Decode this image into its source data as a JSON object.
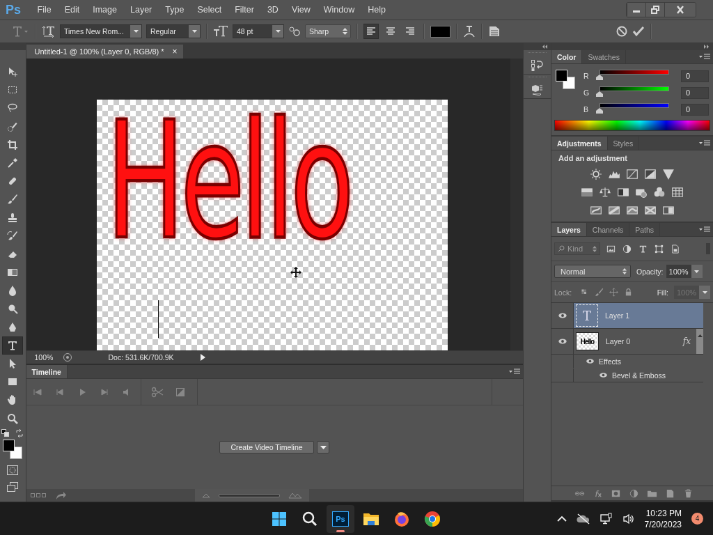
{
  "app": {
    "logo": "Ps",
    "menus": [
      "File",
      "Edit",
      "Image",
      "Layer",
      "Type",
      "Select",
      "Filter",
      "3D",
      "View",
      "Window",
      "Help"
    ]
  },
  "options_bar": {
    "font_family": "Times New Rom...",
    "font_style": "Regular",
    "font_size": "48 pt",
    "antialias": "Sharp",
    "align": [
      {
        "kind": "left",
        "selected": true
      },
      {
        "kind": "center",
        "selected": false
      },
      {
        "kind": "right",
        "selected": false
      }
    ]
  },
  "tools": [
    {
      "kind": "move",
      "selected": false
    },
    {
      "kind": "marquee",
      "selected": false
    },
    {
      "kind": "lasso",
      "selected": false
    },
    {
      "kind": "quick-select",
      "selected": false
    },
    {
      "kind": "crop",
      "selected": false
    },
    {
      "kind": "eyedropper",
      "selected": false
    },
    {
      "kind": "healing",
      "selected": false
    },
    {
      "kind": "brush",
      "selected": false
    },
    {
      "kind": "stamp",
      "selected": false
    },
    {
      "kind": "history-brush",
      "selected": false
    },
    {
      "kind": "eraser",
      "selected": false
    },
    {
      "kind": "gradient",
      "selected": false
    },
    {
      "kind": "blur",
      "selected": false
    },
    {
      "kind": "dodge",
      "selected": false
    },
    {
      "kind": "pen",
      "selected": false
    },
    {
      "kind": "type",
      "selected": true
    },
    {
      "kind": "path-select",
      "selected": false
    },
    {
      "kind": "shape",
      "selected": false
    },
    {
      "kind": "hand",
      "selected": false
    },
    {
      "kind": "zoom",
      "selected": false
    }
  ],
  "document": {
    "tab_title": "Untitled-1 @ 100% (Layer 0, RGB/8) *",
    "close": "×",
    "artwork_text": "Hello",
    "zoom": "100%",
    "doc_info": "Doc: 531.6K/700.9K"
  },
  "timeline": {
    "title": "Timeline",
    "button": "Create Video Timeline"
  },
  "color_panel": {
    "tabs": [
      {
        "label": "Color",
        "selected": true
      },
      {
        "label": "Swatches",
        "selected": false
      }
    ],
    "channels": [
      {
        "name": "R",
        "level": 0,
        "value": "0"
      },
      {
        "name": "G",
        "level": 0,
        "value": "0"
      },
      {
        "name": "B",
        "level": 0,
        "value": "0"
      }
    ]
  },
  "adjustments_panel": {
    "tabs": [
      {
        "label": "Adjustments",
        "selected": true
      },
      {
        "label": "Styles",
        "selected": false
      }
    ],
    "heading": "Add an adjustment"
  },
  "layers_panel": {
    "tabs": [
      {
        "label": "Layers",
        "selected": true
      },
      {
        "label": "Channels",
        "selected": false
      },
      {
        "label": "Paths",
        "selected": false
      }
    ],
    "filter": "Kind",
    "blend_mode": "Normal",
    "opacity_label": "Opacity:",
    "opacity": "100%",
    "lock_label": "Lock:",
    "fill_label": "Fill:",
    "fill": "100%",
    "fill_disabled": true,
    "layers": [
      {
        "name": "Layer 1",
        "kind": "type",
        "thumb": "T",
        "visible": true,
        "selected": true
      },
      {
        "name": "Layer 0",
        "kind": "raster",
        "thumb": "Hello",
        "visible": true,
        "selected": false,
        "fx": "fx",
        "children": [
          {
            "name": "Effects",
            "visible": true,
            "children": [
              {
                "name": "Bevel & Emboss",
                "visible": true
              }
            ]
          }
        ]
      }
    ]
  },
  "taskbar": {
    "apps": [
      {
        "kind": "start",
        "active": false
      },
      {
        "kind": "search",
        "active": false
      },
      {
        "kind": "photoshop",
        "label": "Ps",
        "active": true
      },
      {
        "kind": "explorer",
        "active": false
      },
      {
        "kind": "firefox",
        "active": false
      },
      {
        "kind": "chrome",
        "active": false
      }
    ],
    "time": "10:23 PM",
    "date": "7/20/2023",
    "badge": "4"
  }
}
